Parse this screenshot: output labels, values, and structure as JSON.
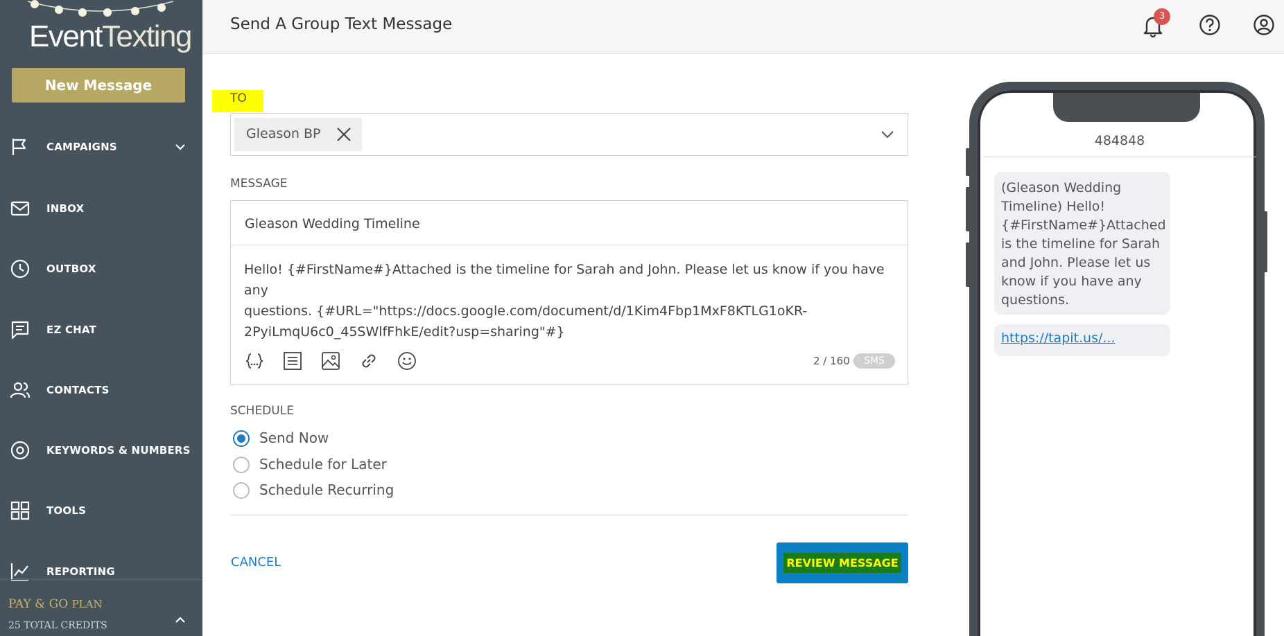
{
  "sidebar": {
    "logo_text_a": "Event",
    "logo_text_b": "Texting",
    "new_message": "New Message",
    "items": [
      {
        "label": "CAMPAIGNS",
        "icon": "flag-icon"
      },
      {
        "label": "INBOX",
        "icon": "envelope-icon"
      },
      {
        "label": "OUTBOX",
        "icon": "clock-icon"
      },
      {
        "label": "EZ CHAT",
        "icon": "chat-icon"
      },
      {
        "label": "CONTACTS",
        "icon": "users-icon"
      },
      {
        "label": "KEYWORDS & NUMBERS",
        "icon": "target-icon"
      },
      {
        "label": "TOOLS",
        "icon": "grid-icon"
      },
      {
        "label": "REPORTING",
        "icon": "chart-icon"
      }
    ],
    "plan_name": "PAY & GO",
    "plan_suffix": "PLAN",
    "credits": "25 TOTAL CREDITS"
  },
  "header": {
    "title": "Send A Group Text Message",
    "notification_count": "3"
  },
  "form": {
    "to_label": "TO",
    "recipient_chip": "Gleason BP",
    "message_label": "MESSAGE",
    "subject": "Gleason Wedding Timeline",
    "body_line1": "Hello! {#FirstName#}Attached is the timeline for Sarah and John. Please let us know if you have any",
    "body_line2": "questions. {#URL=\"https://docs.google.com/document/d/1Kim4Fbp1MxF8KTLG1oKR-",
    "body_line3": "2PyiLmqU6c0_45SWlfFhkE/edit?usp=sharing\"#}",
    "char_count": "2 / 160",
    "sms_badge": "SMS",
    "schedule_label": "SCHEDULE",
    "schedule_options": [
      "Send Now",
      "Schedule for Later",
      "Schedule Recurring"
    ],
    "selected_schedule": "Send Now",
    "cancel": "CANCEL",
    "review": "REVIEW MESSAGE"
  },
  "preview": {
    "number": "484848",
    "bubble_text": "(Gleason Wedding Timeline) Hello! {#FirstName#}Attached is the timeline for Sarah and John. Please let us know if you have any questions.",
    "link_text": "https://tapit.us/..."
  },
  "colors": {
    "sidebar_bg": "#46525c",
    "gold": "#b8a866",
    "accent_blue": "#0c80c5",
    "highlight_yellow": "#ffff00",
    "highlight_green": "#1a7b1a",
    "badge_red": "#d9534f"
  }
}
